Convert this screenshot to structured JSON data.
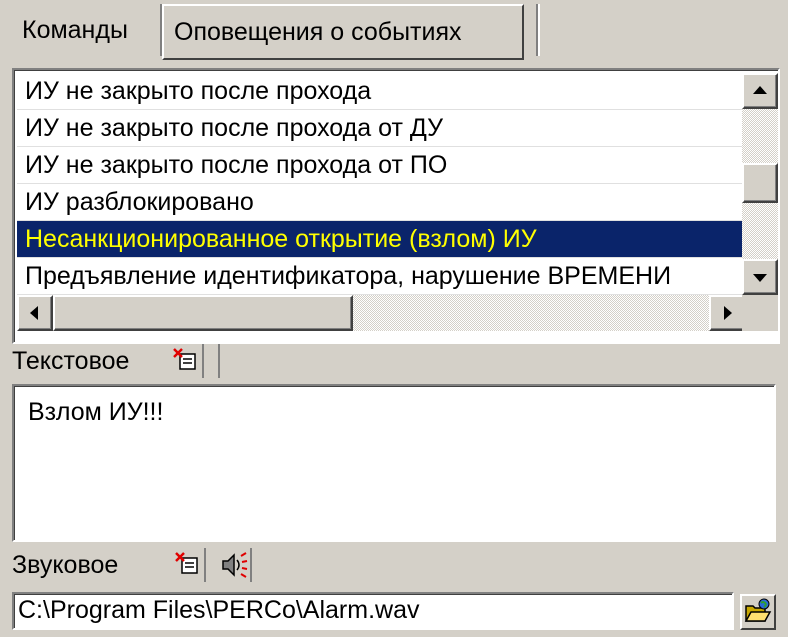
{
  "tabs": [
    {
      "label": "Команды"
    },
    {
      "label": "Оповещения о событиях"
    }
  ],
  "events": {
    "items": [
      {
        "label": "ИУ не закрыто после прохода"
      },
      {
        "label": "ИУ не закрыто после прохода от ДУ"
      },
      {
        "label": "ИУ не закрыто после прохода от ПО"
      },
      {
        "label": "ИУ разблокировано"
      },
      {
        "label": "Несанкционированное открытие (взлом) ИУ",
        "selected": true
      },
      {
        "label": "Предъявление идентификатора, нарушение ВРЕМЕНИ"
      }
    ]
  },
  "text_notify": {
    "label": "Текстовое",
    "value": "Взлом ИУ!!!"
  },
  "sound_notify": {
    "label": "Звуковое",
    "path": "C:\\Program Files\\PERCo\\Alarm.wav"
  },
  "colors": {
    "selection_bg": "#0a246a",
    "selection_fg": "#ffff00",
    "window_bg": "#d4d0c8"
  },
  "icons": [
    "clear-icon",
    "play-sound-icon",
    "open-folder-icon"
  ]
}
